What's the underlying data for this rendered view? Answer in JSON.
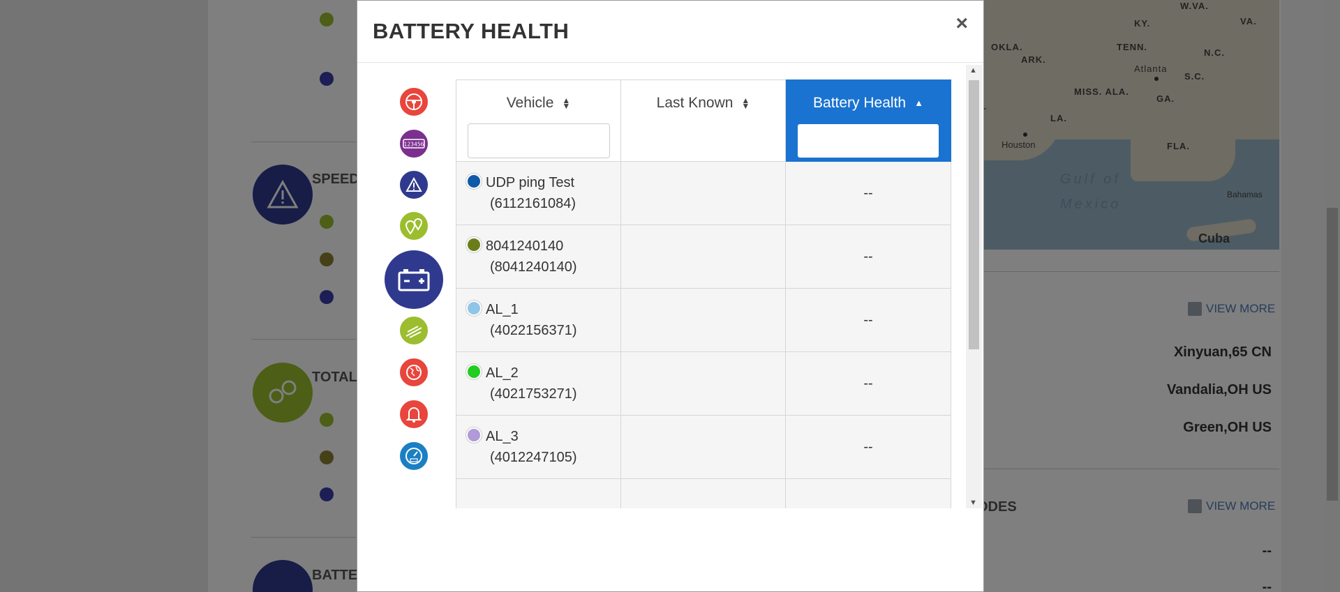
{
  "background": {
    "section_titles": [
      "SPEED",
      "TOTAL",
      "BATTE"
    ],
    "map_labels": [
      "W.VA.",
      "VA.",
      "KY.",
      "OKLA.",
      "TENN.",
      "N.C.",
      "ARK.",
      "Atlanta",
      "S.C.",
      "MISS. ALA.",
      "GA.",
      "LA.",
      "X.",
      "Houston",
      "FLA.",
      "Bahamas",
      "Cuba"
    ],
    "map_sea": [
      "Gulf of",
      "Mexico"
    ],
    "view_more_1": "VIEW MORE",
    "view_more_2": "VIEW MORE",
    "places": [
      "Xinyuan,65 CN",
      "Vandalia,OH US",
      "Green,OH US"
    ],
    "section_odes": "ODES",
    "dash_values": [
      "--",
      "--"
    ]
  },
  "modal": {
    "title": "BATTERY HEALTH",
    "close_label": "×",
    "columns": [
      {
        "label": "Vehicle",
        "sort": "both"
      },
      {
        "label": "Last Known",
        "sort": "both"
      },
      {
        "label": "Battery Health",
        "sort": "asc"
      }
    ],
    "filters": {
      "vehicle": "",
      "battery_health": ""
    },
    "rows": [
      {
        "name": "UDP ping Test",
        "id": "(6112161084)",
        "color": "#0f5aa8",
        "last_known": "",
        "battery_health": "--"
      },
      {
        "name": "8041240140",
        "id": "(8041240140)",
        "color": "#6b7d1a",
        "last_known": "",
        "battery_health": "--"
      },
      {
        "name": "AL_1",
        "id": "(4022156371)",
        "color": "#8fc6e8",
        "last_known": "",
        "battery_health": "--"
      },
      {
        "name": "AL_2",
        "id": "(4021753271)",
        "color": "#22cc22",
        "last_known": "",
        "battery_health": "--"
      },
      {
        "name": "AL_3",
        "id": "(4012247105)",
        "color": "#b09ad8",
        "last_known": "",
        "battery_health": "--"
      },
      {
        "name": "",
        "id": "",
        "color": "#6b2a6e",
        "last_known": "",
        "battery_health": ""
      }
    ],
    "rail_icons": [
      {
        "name": "steering-wheel-icon",
        "color": "#e8453c"
      },
      {
        "name": "odometer-icon",
        "color": "#7b2f8e"
      },
      {
        "name": "warning-icon",
        "color": "#2f3a8f"
      },
      {
        "name": "map-pins-icon",
        "color": "#9bbd2e"
      },
      {
        "name": "battery-icon",
        "color": "#2f3a8f",
        "active": true
      },
      {
        "name": "idle-icon",
        "color": "#9bbd2e"
      },
      {
        "name": "globe-icon",
        "color": "#e8453c"
      },
      {
        "name": "bell-icon",
        "color": "#e8453c"
      },
      {
        "name": "speedometer-icon",
        "color": "#1b7fc4"
      }
    ]
  }
}
